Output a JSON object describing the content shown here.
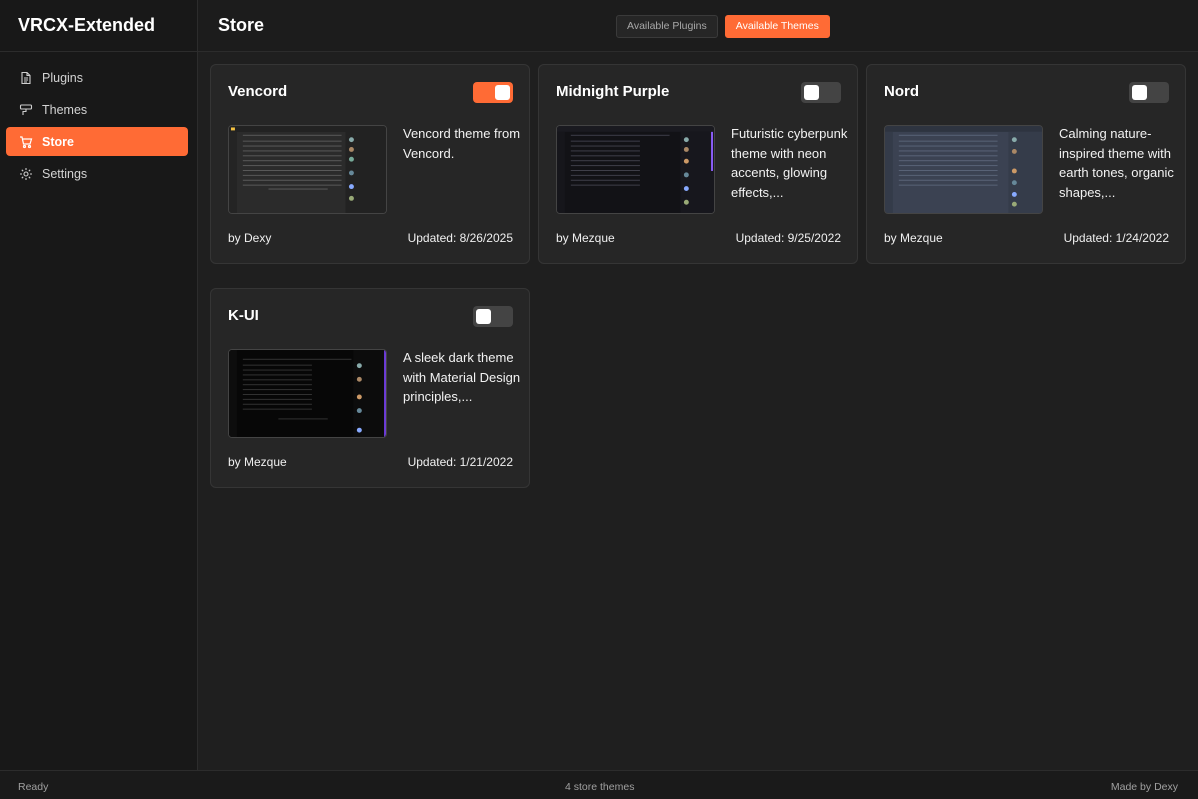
{
  "app": {
    "title": "VRCX-Extended"
  },
  "sidebar": {
    "items": [
      {
        "label": "Plugins",
        "icon": "document-icon",
        "active": false
      },
      {
        "label": "Themes",
        "icon": "paint-roller-icon",
        "active": false
      },
      {
        "label": "Store",
        "icon": "cart-icon",
        "active": true
      },
      {
        "label": "Settings",
        "icon": "gear-icon",
        "active": false
      }
    ]
  },
  "header": {
    "title": "Store",
    "tabs": [
      {
        "label": "Available Plugins",
        "active": false
      },
      {
        "label": "Available Themes",
        "active": true
      }
    ]
  },
  "themes": [
    {
      "name": "Vencord",
      "enabled": true,
      "description": "Vencord theme from Vencord.",
      "author": "by Dexy",
      "updated": "Updated: 8/26/2025",
      "preview": "vencord"
    },
    {
      "name": "Midnight Purple",
      "enabled": false,
      "description": "Futuristic cyberpunk theme with neon accents, glowing effects,...",
      "author": "by Mezque",
      "updated": "Updated: 9/25/2022",
      "preview": "midnight"
    },
    {
      "name": "Nord",
      "enabled": false,
      "description": "Calming nature-inspired theme with earth tones, organic shapes,...",
      "author": "by Mezque",
      "updated": "Updated: 1/24/2022",
      "preview": "nord"
    },
    {
      "name": "K-UI",
      "enabled": false,
      "description": "A sleek dark theme with Material Design principles,...",
      "author": "by Mezque",
      "updated": "Updated: 1/21/2022",
      "preview": "kui"
    }
  ],
  "status": {
    "left": "Ready",
    "center": "4 store themes",
    "right": "Made by Dexy"
  },
  "colors": {
    "accent": "#ff6b35",
    "background": "#1f1f1f",
    "card": "#262626",
    "sidebar": "#181818"
  }
}
